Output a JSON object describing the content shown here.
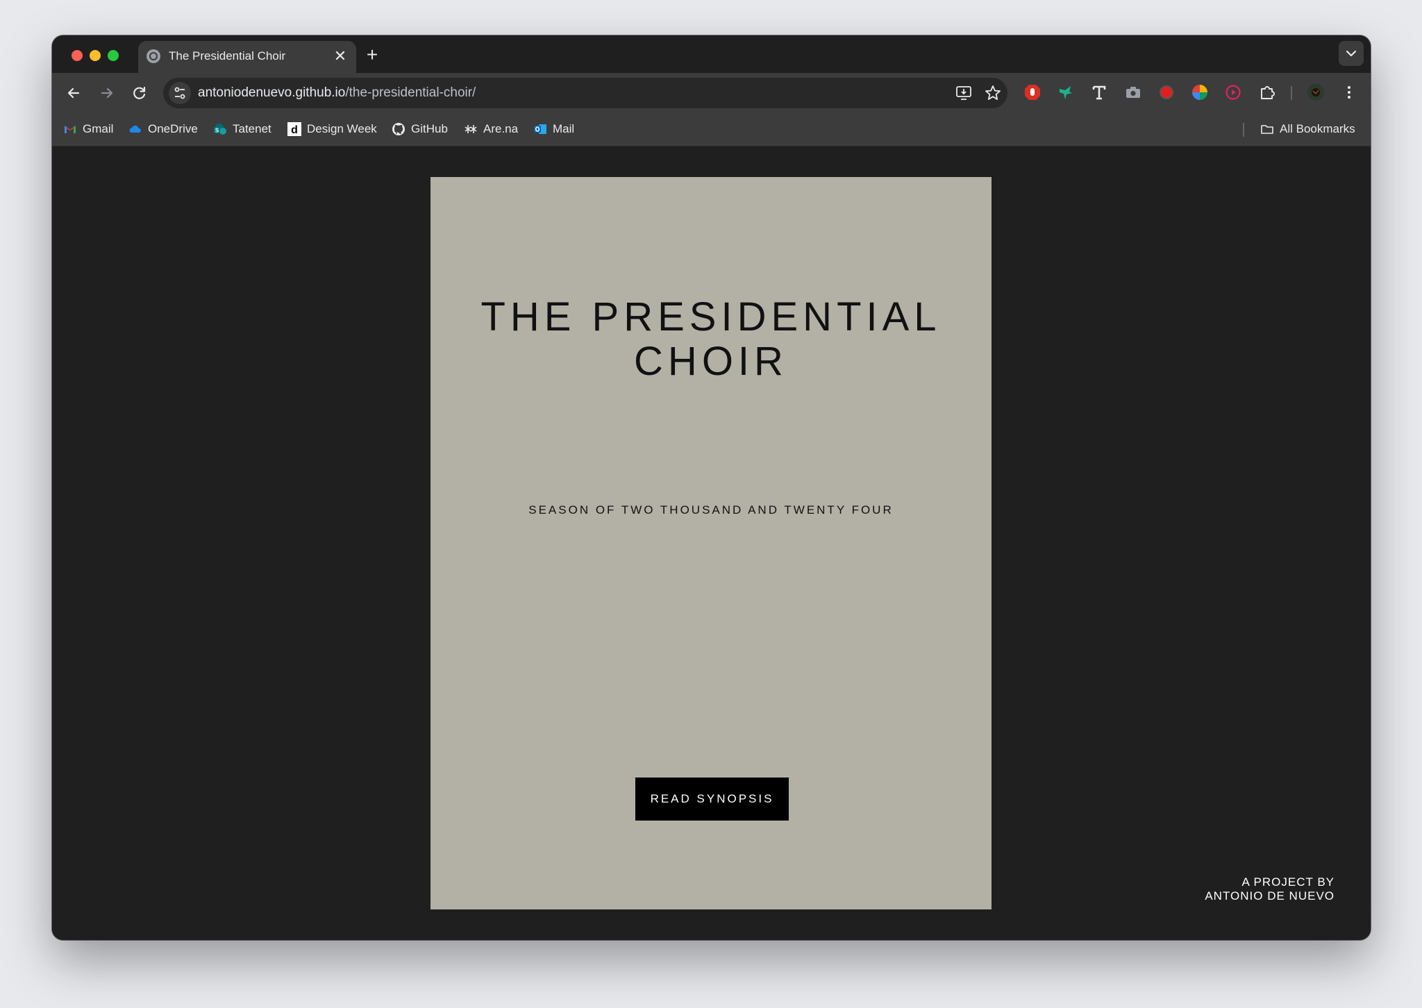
{
  "browser": {
    "tab": {
      "title": "The Presidential Choir",
      "close": "✕"
    },
    "new_tab": "+",
    "url": {
      "host": "antoniodenuevo.github.io",
      "path": "/the-presidential-choir/"
    },
    "bookmarks": [
      {
        "label": "Gmail",
        "icon": "gmail-icon"
      },
      {
        "label": "OneDrive",
        "icon": "onedrive-icon"
      },
      {
        "label": "Tatenet",
        "icon": "sharepoint-icon"
      },
      {
        "label": "Design Week",
        "icon": "design-week-icon"
      },
      {
        "label": "GitHub",
        "icon": "github-icon"
      },
      {
        "label": "Are.na",
        "icon": "arena-icon"
      },
      {
        "label": "Mail",
        "icon": "outlook-icon"
      }
    ],
    "all_bookmarks": "All Bookmarks"
  },
  "page": {
    "title_line1": "THE PRESIDENTIAL",
    "title_line2": "CHOIR",
    "season": "SEASON OF TWO THOUSAND AND TWENTY FOUR",
    "cta": "READ SYNOPSIS",
    "credit_line1": "A PROJECT BY",
    "credit_line2": "ANTONIO DE NUEVO"
  },
  "colors": {
    "poster_bg": "#b3b0a5",
    "page_bg": "#1f1f1f",
    "button_bg": "#000000"
  }
}
